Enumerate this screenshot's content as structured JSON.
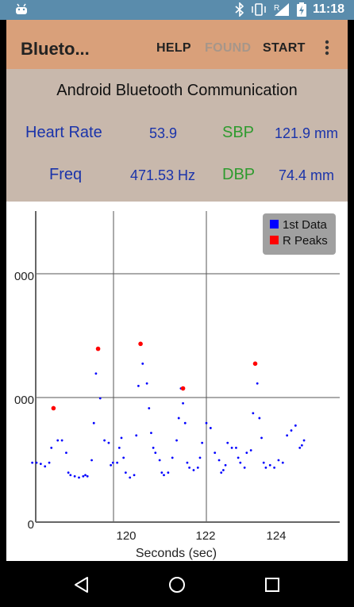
{
  "status_bar": {
    "time": "11:18",
    "icons": [
      "android-notification-icon",
      "bluetooth-icon",
      "vibrate-icon",
      "signal-icon",
      "battery-charging-icon"
    ],
    "signal_label": "R"
  },
  "app_bar": {
    "title": "Blueto...",
    "menu": {
      "help": "HELP",
      "found": "FOUND",
      "start": "START"
    }
  },
  "info": {
    "title": "Android Bluetooth Communication",
    "heart_rate_label": "Heart Rate",
    "heart_rate_value": "53.9",
    "sbp_label": "SBP",
    "sbp_value": "121.9 mm",
    "freq_label": "Freq",
    "freq_value": "471.53 Hz",
    "dbp_label": "DBP",
    "dbp_value": "74.4 mm"
  },
  "colors": {
    "status_bar": "#5a8cac",
    "app_bar": "#d9a07a",
    "info_panel": "#c8b8ac",
    "label_blue": "#1a33aa",
    "label_green": "#2e9b2e",
    "series_data": "#0000ff",
    "series_peaks": "#ff0000"
  },
  "chart_data": {
    "type": "scatter",
    "xlabel": "Seconds (sec)",
    "x_ticks": [
      "120",
      "122",
      "124"
    ],
    "y_ticks": [
      "0",
      "000",
      "000"
    ],
    "grid": true,
    "legend_position": "top-right",
    "series": [
      {
        "name": "1st Data",
        "color": "#0000ff",
        "points": [
          [
            117.9,
            240
          ],
          [
            118.0,
            240
          ],
          [
            118.1,
            235
          ],
          [
            118.2,
            225
          ],
          [
            118.3,
            240
          ],
          [
            118.35,
            300
          ],
          [
            118.4,
            460
          ],
          [
            118.5,
            330
          ],
          [
            118.6,
            330
          ],
          [
            118.7,
            280
          ],
          [
            118.75,
            200
          ],
          [
            118.8,
            190
          ],
          [
            118.9,
            185
          ],
          [
            119.0,
            180
          ],
          [
            119.1,
            185
          ],
          [
            119.15,
            190
          ],
          [
            119.2,
            185
          ],
          [
            119.3,
            250
          ],
          [
            119.35,
            400
          ],
          [
            119.4,
            600
          ],
          [
            119.45,
            700
          ],
          [
            119.5,
            500
          ],
          [
            119.6,
            330
          ],
          [
            119.7,
            320
          ],
          [
            119.75,
            230
          ],
          [
            119.8,
            240
          ],
          [
            119.9,
            240
          ],
          [
            119.95,
            300
          ],
          [
            120.0,
            340
          ],
          [
            120.05,
            260
          ],
          [
            120.1,
            200
          ],
          [
            120.2,
            180
          ],
          [
            120.3,
            190
          ],
          [
            120.35,
            350
          ],
          [
            120.4,
            550
          ],
          [
            120.45,
            720
          ],
          [
            120.5,
            640
          ],
          [
            120.6,
            560
          ],
          [
            120.65,
            460
          ],
          [
            120.7,
            360
          ],
          [
            120.75,
            300
          ],
          [
            120.8,
            280
          ],
          [
            120.9,
            250
          ],
          [
            120.95,
            200
          ],
          [
            121.0,
            190
          ],
          [
            121.1,
            200
          ],
          [
            121.2,
            260
          ],
          [
            121.3,
            330
          ],
          [
            121.35,
            420
          ],
          [
            121.4,
            540
          ],
          [
            121.45,
            480
          ],
          [
            121.5,
            400
          ],
          [
            121.55,
            240
          ],
          [
            121.6,
            220
          ],
          [
            121.7,
            210
          ],
          [
            121.8,
            220
          ],
          [
            121.85,
            260
          ],
          [
            121.9,
            320
          ],
          [
            122.0,
            400
          ],
          [
            122.1,
            380
          ],
          [
            122.2,
            280
          ],
          [
            122.3,
            250
          ],
          [
            122.35,
            200
          ],
          [
            122.4,
            210
          ],
          [
            122.45,
            230
          ],
          [
            122.5,
            320
          ],
          [
            122.6,
            300
          ],
          [
            122.7,
            300
          ],
          [
            122.75,
            260
          ],
          [
            122.8,
            240
          ],
          [
            122.9,
            220
          ],
          [
            122.95,
            280
          ],
          [
            123.05,
            290
          ],
          [
            123.1,
            440
          ],
          [
            123.15,
            640
          ],
          [
            123.2,
            560
          ],
          [
            123.25,
            420
          ],
          [
            123.3,
            340
          ],
          [
            123.35,
            240
          ],
          [
            123.4,
            220
          ],
          [
            123.5,
            230
          ],
          [
            123.6,
            220
          ],
          [
            123.7,
            250
          ],
          [
            123.8,
            240
          ],
          [
            123.9,
            350
          ],
          [
            124.0,
            370
          ],
          [
            124.1,
            390
          ],
          [
            124.2,
            300
          ],
          [
            124.25,
            310
          ],
          [
            124.3,
            330
          ]
        ]
      },
      {
        "name": "R Peaks",
        "color": "#ff0000",
        "points": [
          [
            118.4,
            460
          ],
          [
            119.45,
            700
          ],
          [
            120.45,
            720
          ],
          [
            121.45,
            540
          ],
          [
            123.15,
            640
          ]
        ]
      }
    ]
  },
  "nav": {
    "back": "back-icon",
    "home": "home-icon",
    "recents": "recents-icon"
  }
}
